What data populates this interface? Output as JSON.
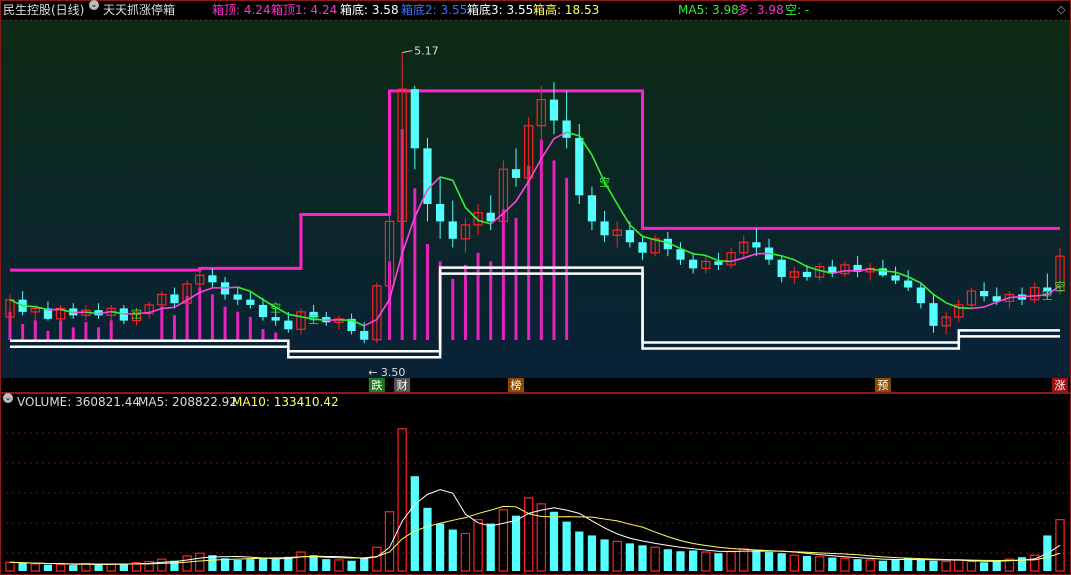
{
  "header": {
    "stock_title": "民生控股(日线)",
    "indicator_name": "天天抓涨停箱",
    "box_top_label": "箱顶: 4.24",
    "box_top1_label": "箱顶1: 4.24",
    "box_bottom_label": "箱底: 3.58",
    "box_bottom2_label": "箱底2: 3.55",
    "box_bottom3_label": "箱底3: 3.55",
    "box_height_label": "箱高: 18.53",
    "ma5_label": "MA5: 3.98",
    "duo_label": "多: 3.98",
    "kong_label": "空: -"
  },
  "annotations": {
    "high_price": "5.17",
    "low_price": "3.50",
    "kong_marker": "空"
  },
  "bottom_markers": [
    {
      "label": "跌",
      "color": "#1b7a1b"
    },
    {
      "label": "财",
      "color": "#555555"
    },
    {
      "label": "榜",
      "color": "#8a4a00"
    },
    {
      "label": "预",
      "color": "#8a4a00"
    },
    {
      "label": "涨",
      "color": "#a01010"
    }
  ],
  "volume_header": {
    "volume_label": "VOLUME: 360821.44",
    "ma5_label": "MA5: 208822.92",
    "ma10_label": "MA10: 133410.42"
  },
  "colors": {
    "up": "#ff2222",
    "down": "#55ffff",
    "box": "#ff22cc",
    "ma_green": "#33ee33",
    "white": "#ffffff",
    "vol_ma5": "#ffffff",
    "vol_ma10": "#ffff66"
  },
  "chart_data": {
    "type": "candlestick",
    "price_range": [
      3.3,
      5.3
    ],
    "candles": [
      {
        "o": 3.65,
        "h": 3.78,
        "l": 3.6,
        "c": 3.75
      },
      {
        "o": 3.75,
        "h": 3.8,
        "l": 3.66,
        "c": 3.68
      },
      {
        "o": 3.68,
        "h": 3.72,
        "l": 3.62,
        "c": 3.7
      },
      {
        "o": 3.7,
        "h": 3.74,
        "l": 3.63,
        "c": 3.64
      },
      {
        "o": 3.64,
        "h": 3.72,
        "l": 3.62,
        "c": 3.7
      },
      {
        "o": 3.7,
        "h": 3.73,
        "l": 3.64,
        "c": 3.66
      },
      {
        "o": 3.66,
        "h": 3.72,
        "l": 3.63,
        "c": 3.69
      },
      {
        "o": 3.69,
        "h": 3.73,
        "l": 3.64,
        "c": 3.66
      },
      {
        "o": 3.66,
        "h": 3.72,
        "l": 3.62,
        "c": 3.7
      },
      {
        "o": 3.7,
        "h": 3.72,
        "l": 3.61,
        "c": 3.63
      },
      {
        "o": 3.63,
        "h": 3.7,
        "l": 3.6,
        "c": 3.67
      },
      {
        "o": 3.67,
        "h": 3.74,
        "l": 3.64,
        "c": 3.72
      },
      {
        "o": 3.72,
        "h": 3.8,
        "l": 3.68,
        "c": 3.78
      },
      {
        "o": 3.78,
        "h": 3.82,
        "l": 3.7,
        "c": 3.73
      },
      {
        "o": 3.73,
        "h": 3.86,
        "l": 3.7,
        "c": 3.84
      },
      {
        "o": 3.84,
        "h": 3.92,
        "l": 3.8,
        "c": 3.89
      },
      {
        "o": 3.89,
        "h": 3.93,
        "l": 3.82,
        "c": 3.85
      },
      {
        "o": 3.85,
        "h": 3.88,
        "l": 3.75,
        "c": 3.78
      },
      {
        "o": 3.78,
        "h": 3.82,
        "l": 3.72,
        "c": 3.75
      },
      {
        "o": 3.75,
        "h": 3.8,
        "l": 3.7,
        "c": 3.72
      },
      {
        "o": 3.72,
        "h": 3.76,
        "l": 3.63,
        "c": 3.65
      },
      {
        "o": 3.65,
        "h": 3.7,
        "l": 3.6,
        "c": 3.63
      },
      {
        "o": 3.63,
        "h": 3.68,
        "l": 3.56,
        "c": 3.58
      },
      {
        "o": 3.58,
        "h": 3.7,
        "l": 3.55,
        "c": 3.68
      },
      {
        "o": 3.68,
        "h": 3.72,
        "l": 3.63,
        "c": 3.65
      },
      {
        "o": 3.65,
        "h": 3.68,
        "l": 3.6,
        "c": 3.62
      },
      {
        "o": 3.62,
        "h": 3.66,
        "l": 3.58,
        "c": 3.64
      },
      {
        "o": 3.64,
        "h": 3.67,
        "l": 3.55,
        "c": 3.57
      },
      {
        "o": 3.57,
        "h": 3.62,
        "l": 3.5,
        "c": 3.52
      },
      {
        "o": 3.52,
        "h": 3.85,
        "l": 3.5,
        "c": 3.83
      },
      {
        "o": 3.83,
        "h": 4.24,
        "l": 3.8,
        "c": 4.2
      },
      {
        "o": 4.2,
        "h": 5.17,
        "l": 4.1,
        "c": 4.96
      },
      {
        "o": 4.96,
        "h": 4.98,
        "l": 4.5,
        "c": 4.62
      },
      {
        "o": 4.62,
        "h": 4.68,
        "l": 4.2,
        "c": 4.3
      },
      {
        "o": 4.3,
        "h": 4.45,
        "l": 4.1,
        "c": 4.2
      },
      {
        "o": 4.2,
        "h": 4.32,
        "l": 4.05,
        "c": 4.1
      },
      {
        "o": 4.1,
        "h": 4.22,
        "l": 4.02,
        "c": 4.18
      },
      {
        "o": 4.18,
        "h": 4.3,
        "l": 4.12,
        "c": 4.25
      },
      {
        "o": 4.25,
        "h": 4.35,
        "l": 4.15,
        "c": 4.2
      },
      {
        "o": 4.2,
        "h": 4.55,
        "l": 4.18,
        "c": 4.5
      },
      {
        "o": 4.5,
        "h": 4.62,
        "l": 4.4,
        "c": 4.45
      },
      {
        "o": 4.45,
        "h": 4.8,
        "l": 4.42,
        "c": 4.75
      },
      {
        "o": 4.75,
        "h": 4.98,
        "l": 4.65,
        "c": 4.9
      },
      {
        "o": 4.9,
        "h": 5.0,
        "l": 4.7,
        "c": 4.78
      },
      {
        "o": 4.78,
        "h": 4.95,
        "l": 4.62,
        "c": 4.68
      },
      {
        "o": 4.68,
        "h": 4.76,
        "l": 4.3,
        "c": 4.35
      },
      {
        "o": 4.35,
        "h": 4.4,
        "l": 4.15,
        "c": 4.2
      },
      {
        "o": 4.2,
        "h": 4.26,
        "l": 4.08,
        "c": 4.12
      },
      {
        "o": 4.12,
        "h": 4.2,
        "l": 4.05,
        "c": 4.15
      },
      {
        "o": 4.15,
        "h": 4.2,
        "l": 4.05,
        "c": 4.08
      },
      {
        "o": 4.08,
        "h": 4.12,
        "l": 3.98,
        "c": 4.02
      },
      {
        "o": 4.02,
        "h": 4.12,
        "l": 4.0,
        "c": 4.1
      },
      {
        "o": 4.1,
        "h": 4.14,
        "l": 4.0,
        "c": 4.04
      },
      {
        "o": 4.04,
        "h": 4.08,
        "l": 3.95,
        "c": 3.98
      },
      {
        "o": 3.98,
        "h": 4.02,
        "l": 3.9,
        "c": 3.93
      },
      {
        "o": 3.93,
        "h": 4.0,
        "l": 3.9,
        "c": 3.97
      },
      {
        "o": 3.97,
        "h": 4.02,
        "l": 3.92,
        "c": 3.95
      },
      {
        "o": 3.95,
        "h": 4.05,
        "l": 3.93,
        "c": 4.02
      },
      {
        "o": 4.02,
        "h": 4.12,
        "l": 3.98,
        "c": 4.08
      },
      {
        "o": 4.08,
        "h": 4.16,
        "l": 4.0,
        "c": 4.05
      },
      {
        "o": 4.05,
        "h": 4.1,
        "l": 3.95,
        "c": 3.98
      },
      {
        "o": 3.98,
        "h": 4.0,
        "l": 3.85,
        "c": 3.88
      },
      {
        "o": 3.88,
        "h": 3.94,
        "l": 3.84,
        "c": 3.91
      },
      {
        "o": 3.91,
        "h": 3.95,
        "l": 3.86,
        "c": 3.88
      },
      {
        "o": 3.88,
        "h": 3.96,
        "l": 3.86,
        "c": 3.94
      },
      {
        "o": 3.94,
        "h": 3.98,
        "l": 3.88,
        "c": 3.9
      },
      {
        "o": 3.9,
        "h": 3.97,
        "l": 3.88,
        "c": 3.95
      },
      {
        "o": 3.95,
        "h": 4.0,
        "l": 3.88,
        "c": 3.91
      },
      {
        "o": 3.91,
        "h": 3.96,
        "l": 3.86,
        "c": 3.93
      },
      {
        "o": 3.93,
        "h": 3.98,
        "l": 3.88,
        "c": 3.89
      },
      {
        "o": 3.89,
        "h": 3.94,
        "l": 3.84,
        "c": 3.86
      },
      {
        "o": 3.86,
        "h": 3.92,
        "l": 3.8,
        "c": 3.82
      },
      {
        "o": 3.82,
        "h": 3.85,
        "l": 3.7,
        "c": 3.73
      },
      {
        "o": 3.73,
        "h": 3.78,
        "l": 3.56,
        "c": 3.6
      },
      {
        "o": 3.6,
        "h": 3.68,
        "l": 3.55,
        "c": 3.65
      },
      {
        "o": 3.65,
        "h": 3.75,
        "l": 3.62,
        "c": 3.72
      },
      {
        "o": 3.72,
        "h": 3.82,
        "l": 3.7,
        "c": 3.8
      },
      {
        "o": 3.8,
        "h": 3.85,
        "l": 3.74,
        "c": 3.77
      },
      {
        "o": 3.77,
        "h": 3.82,
        "l": 3.72,
        "c": 3.74
      },
      {
        "o": 3.74,
        "h": 3.8,
        "l": 3.7,
        "c": 3.78
      },
      {
        "o": 3.78,
        "h": 3.82,
        "l": 3.72,
        "c": 3.75
      },
      {
        "o": 3.75,
        "h": 3.85,
        "l": 3.73,
        "c": 3.82
      },
      {
        "o": 3.82,
        "h": 3.9,
        "l": 3.76,
        "c": 3.8
      },
      {
        "o": 3.8,
        "h": 4.05,
        "l": 3.78,
        "c": 4.0
      }
    ],
    "volume_range": [
      0,
      400000
    ],
    "volumes": [
      22000,
      20000,
      18000,
      16000,
      17000,
      15000,
      19000,
      16000,
      17000,
      18000,
      21000,
      24000,
      30000,
      26000,
      38000,
      45000,
      40000,
      32000,
      28000,
      30000,
      34000,
      30000,
      36000,
      48000,
      40000,
      30000,
      28000,
      26000,
      34000,
      60000,
      150000,
      360000,
      240000,
      160000,
      120000,
      105000,
      95000,
      130000,
      120000,
      155000,
      140000,
      185000,
      170000,
      150000,
      125000,
      100000,
      90000,
      80000,
      75000,
      70000,
      65000,
      60000,
      55000,
      50000,
      52000,
      48000,
      45000,
      50000,
      56000,
      52000,
      48000,
      45000,
      40000,
      38000,
      36000,
      34000,
      32000,
      30000,
      28000,
      26000,
      30000,
      32000,
      28000,
      26000,
      24000,
      28000,
      24000,
      22000,
      26000,
      30000,
      35000,
      40000,
      90000,
      130000
    ]
  }
}
